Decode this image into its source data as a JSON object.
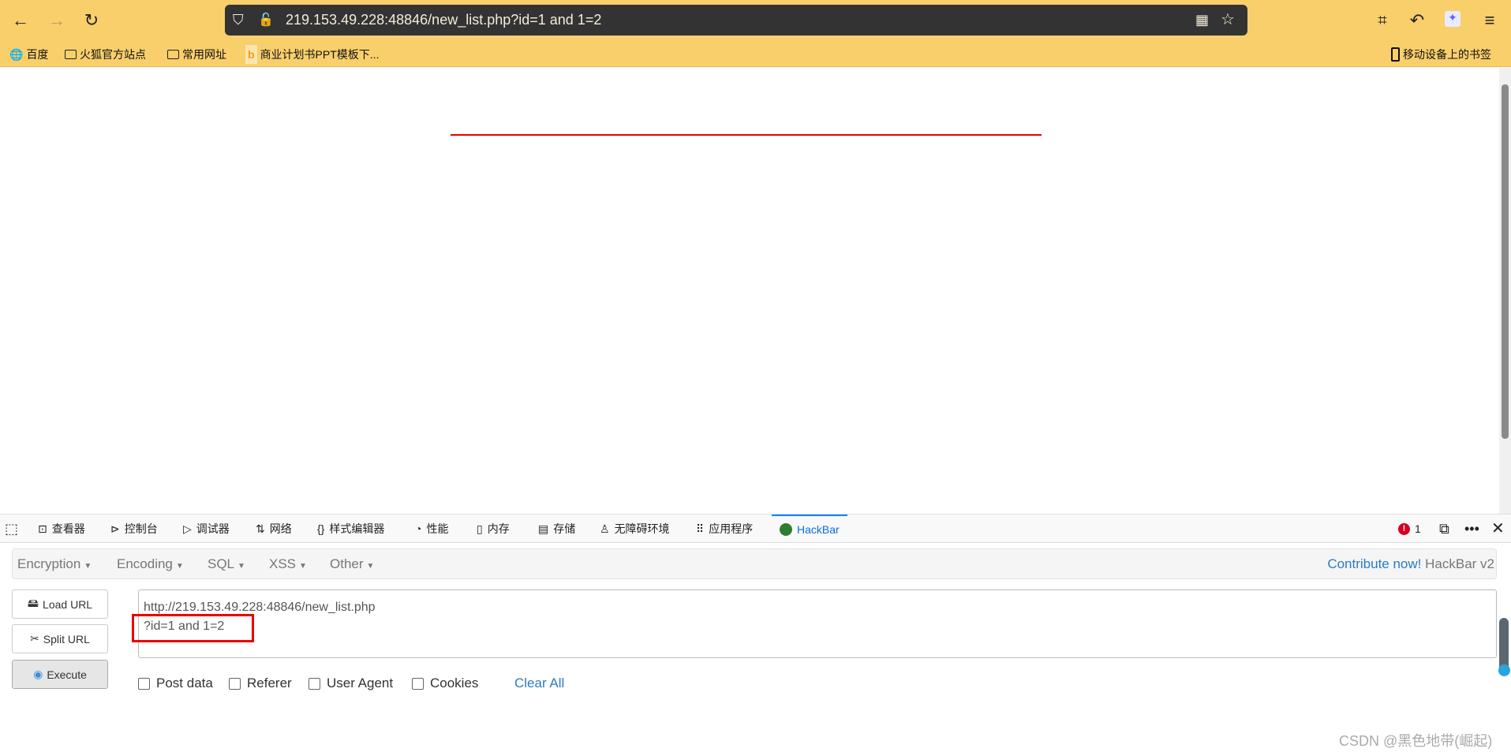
{
  "browser": {
    "url": "219.153.49.228:48846/new_list.php?id=1 and 1=2",
    "bookmarks": [
      "百度",
      "火狐官方站点",
      "常用网址",
      "商业计划书PPT模板下..."
    ],
    "mobile_bookmarks": "移动设备上的书签"
  },
  "devtools": {
    "tabs": [
      "查看器",
      "控制台",
      "调试器",
      "网络",
      "样式编辑器",
      "性能",
      "内存",
      "存储",
      "无障碍环境",
      "应用程序",
      "HackBar"
    ],
    "error_count": "1"
  },
  "hackbar": {
    "menus": [
      "Encryption",
      "Encoding",
      "SQL",
      "XSS",
      "Other"
    ],
    "contribute": "Contribute now!",
    "version": "HackBar v2",
    "buttons": {
      "load": "Load URL",
      "split": "Split URL",
      "execute": "Execute"
    },
    "url_text": "http://219.153.49.228:48846/new_list.php\n?id=1 and 1=2",
    "options": [
      "Post data",
      "Referer",
      "User Agent",
      "Cookies"
    ],
    "clear_all": "Clear All"
  },
  "watermark": "CSDN @黑色地带(崛起)"
}
